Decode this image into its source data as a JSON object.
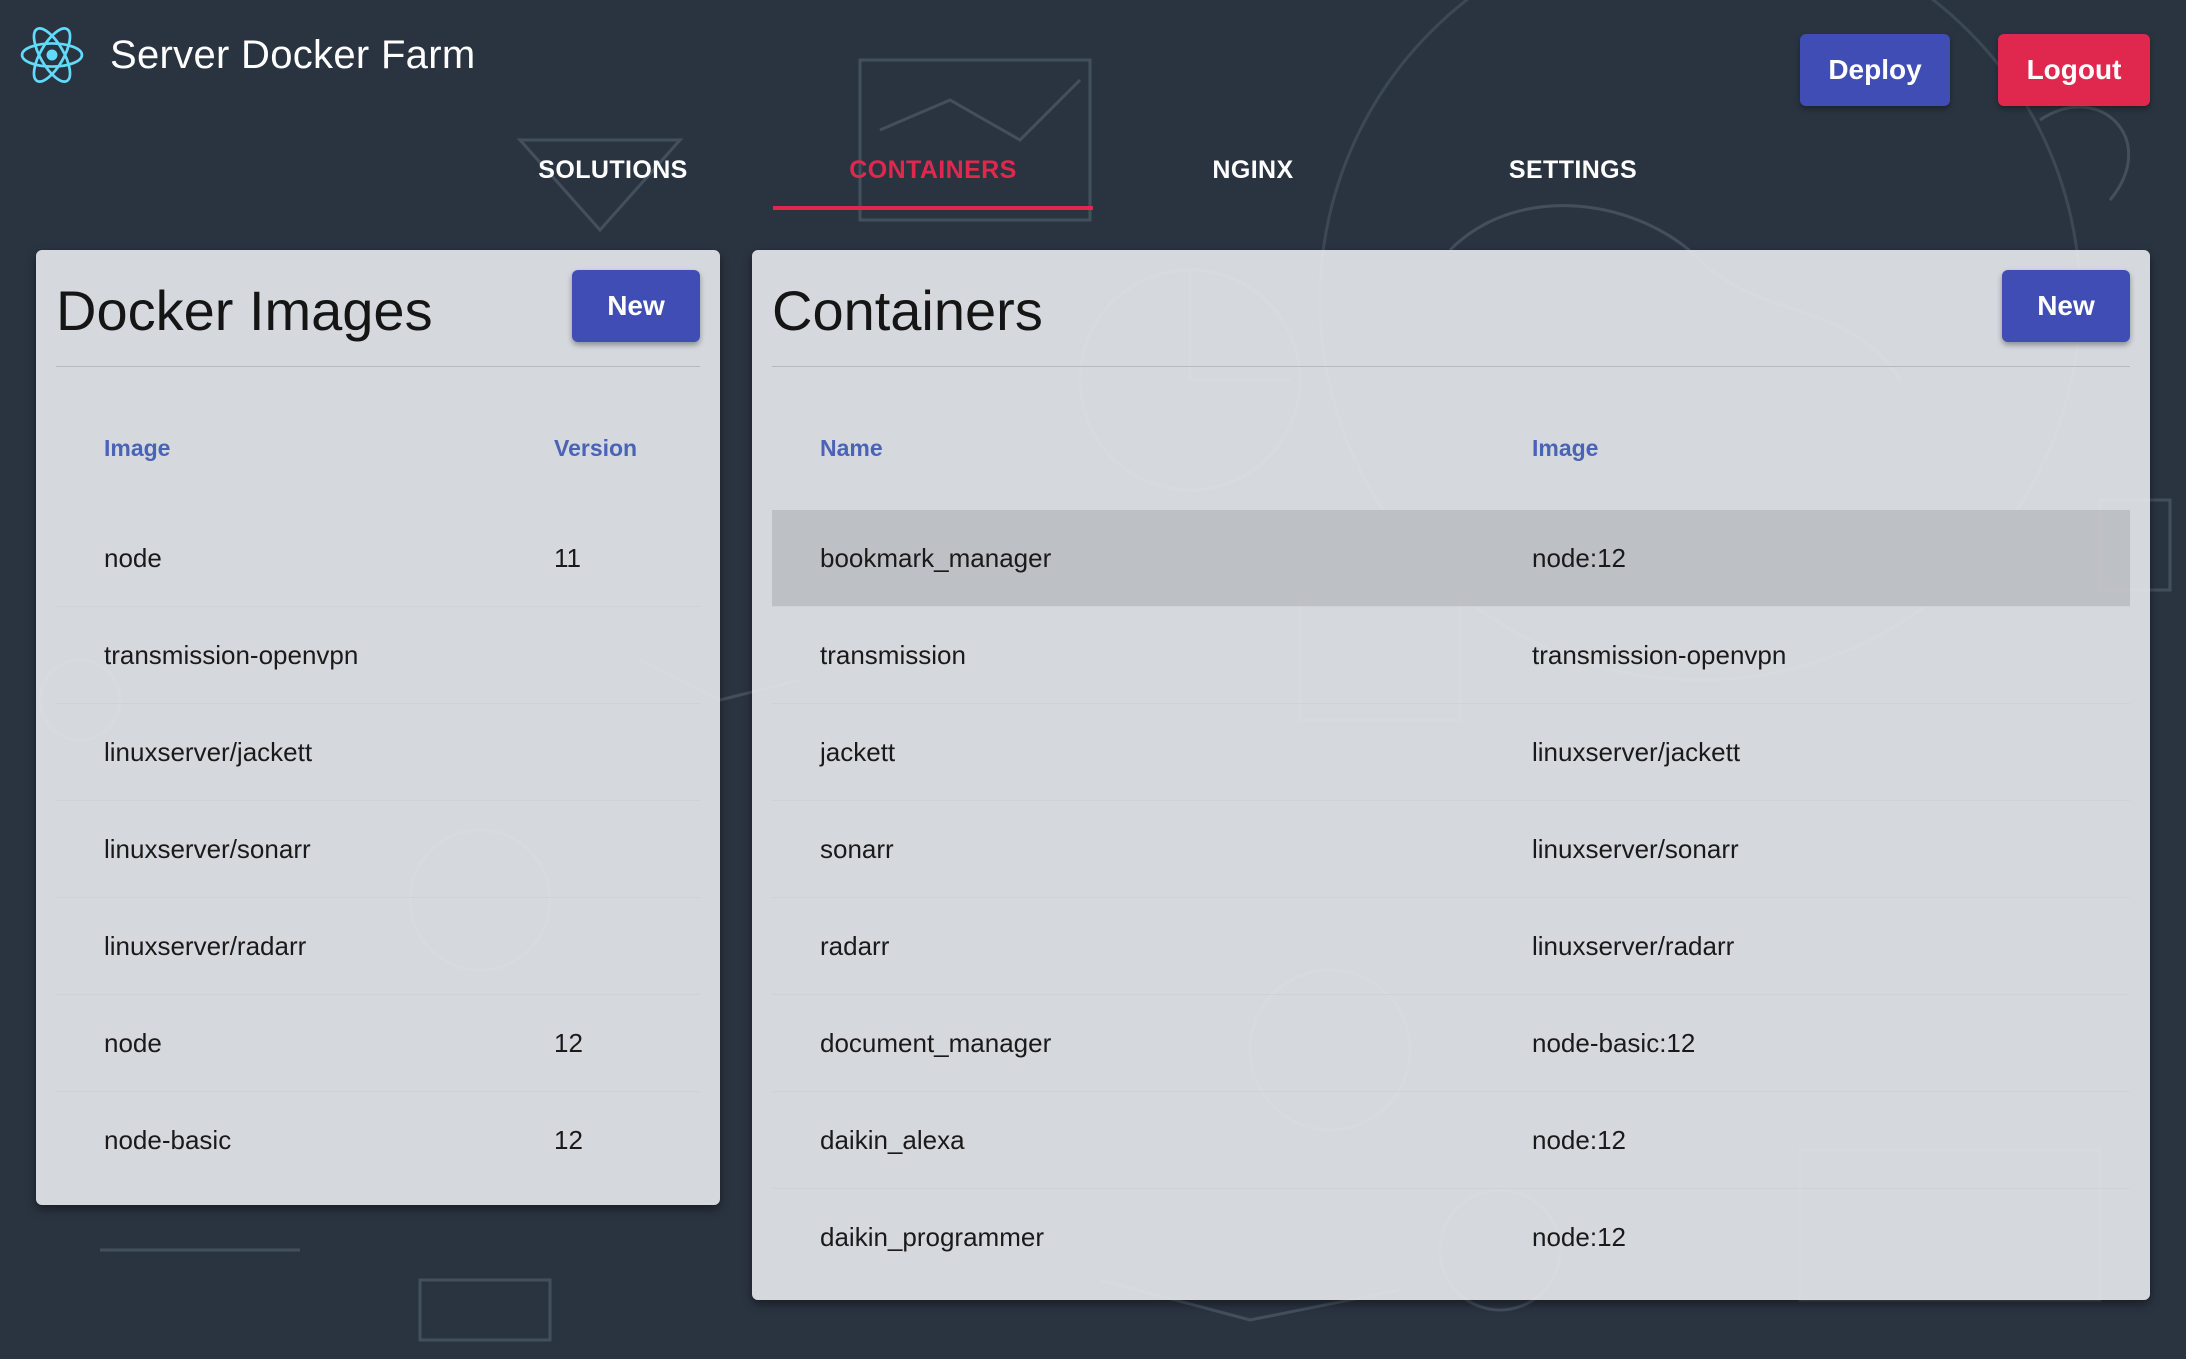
{
  "app": {
    "title": "Server Docker Farm",
    "logo_icon": "react-atom-icon"
  },
  "header": {
    "deploy_label": "Deploy",
    "logout_label": "Logout"
  },
  "tabs": [
    {
      "label": "SOLUTIONS",
      "active": false
    },
    {
      "label": "CONTAINERS",
      "active": true
    },
    {
      "label": "NGINX",
      "active": false
    },
    {
      "label": "SETTINGS",
      "active": false
    }
  ],
  "images_panel": {
    "title": "Docker Images",
    "new_label": "New",
    "columns": [
      "Image",
      "Version"
    ],
    "rows": [
      [
        "node",
        "11"
      ],
      [
        "transmission-openvpn",
        ""
      ],
      [
        "linuxserver/jackett",
        ""
      ],
      [
        "linuxserver/sonarr",
        ""
      ],
      [
        "linuxserver/radarr",
        ""
      ],
      [
        "node",
        "12"
      ],
      [
        "node-basic",
        "12"
      ]
    ]
  },
  "containers_panel": {
    "title": "Containers",
    "new_label": "New",
    "columns": [
      "Name",
      "Image"
    ],
    "selected_row": 0,
    "rows": [
      [
        "bookmark_manager",
        "node:12"
      ],
      [
        "transmission",
        "transmission-openvpn"
      ],
      [
        "jackett",
        "linuxserver/jackett"
      ],
      [
        "sonarr",
        "linuxserver/sonarr"
      ],
      [
        "radarr",
        "linuxserver/radarr"
      ],
      [
        "document_manager",
        "node-basic:12"
      ],
      [
        "daikin_alexa",
        "node:12"
      ],
      [
        "daikin_programmer",
        "node:12"
      ]
    ]
  },
  "colors": {
    "background": "#2a3441",
    "primary": "#3f4db5",
    "accent": "#e0284f",
    "header_text": "#4a63b5"
  }
}
